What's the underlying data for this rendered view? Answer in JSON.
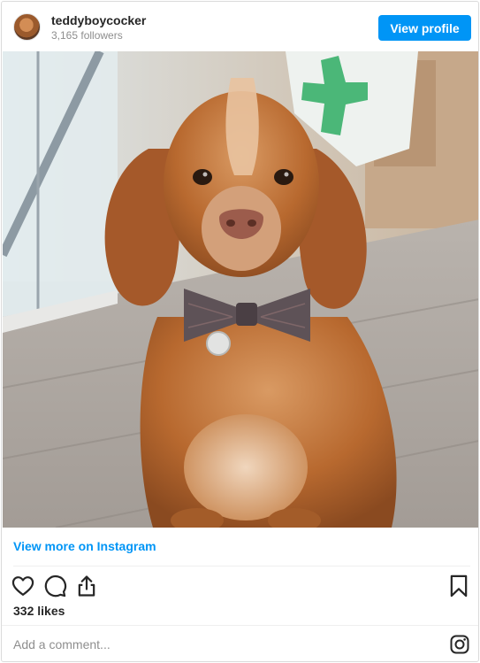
{
  "header": {
    "username": "teddyboycocker",
    "followers": "3,165 followers",
    "view_profile_label": "View profile"
  },
  "post": {
    "photo_icon": "dog-photo"
  },
  "links": {
    "view_more": "View more on Instagram"
  },
  "actions": {
    "icons": [
      "heart-icon",
      "comment-icon",
      "share-icon",
      "bookmark-icon"
    ],
    "likes": "332 likes"
  },
  "comment": {
    "placeholder": "Add a comment...",
    "brand_icon": "instagram-icon"
  },
  "colors": {
    "accent": "#0095f6",
    "text": "#262626",
    "muted": "#8e8e8e",
    "border": "#dbdbdb"
  }
}
